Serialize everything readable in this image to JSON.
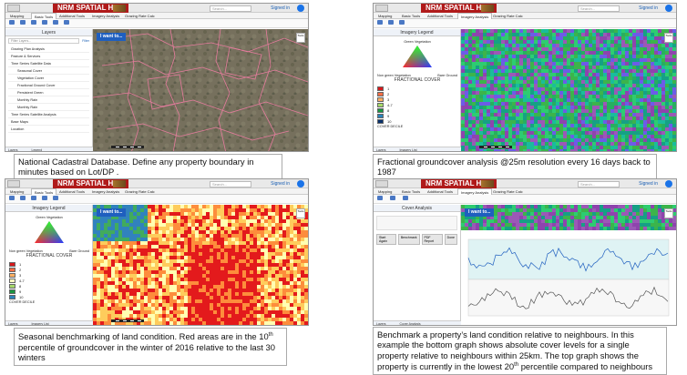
{
  "app": {
    "brand": "NRM SPATIAL HUB",
    "search_placeholder": "Search...",
    "signed_in": "Signed in",
    "tabs": [
      "Mapping",
      "Basic Tools",
      "Additional Tools",
      "Imagery Analysis",
      "Grazing Rate Calc"
    ],
    "i_want_to": "I want to...",
    "tools_label": "Tools"
  },
  "panel1": {
    "sidebar_title": "Layers",
    "filter_placeholder": "Filter Layers...",
    "filter_button": "Filter",
    "layers": [
      "Grazing Plan Analysis",
      "Pasture & Services",
      "Time Series Satellite Data",
      "Seasonal Cover",
      "Vegetation Cover",
      "Fractional Ground Cover",
      "Persistent Green",
      "Monthly Rain",
      "Monthly Rain",
      "Time Series Satellite Analysis",
      "Base Maps",
      "Location"
    ],
    "bottom_tabs": [
      "Layers",
      "Legend"
    ],
    "caption": "National Cadastral Database. Define any property boundary in minutes based on Lot/DP ."
  },
  "panel2": {
    "legend_title": "Imagery Legend",
    "green_label": "Green Vegetation",
    "bare_label": "Bare Ground",
    "non_green_label": "Non green Vegetation",
    "fc_label": "FRACTIONAL COVER",
    "classes": [
      {
        "label": "1",
        "color": "#d7191c"
      },
      {
        "label": "2",
        "color": "#f46d43"
      },
      {
        "label": "3",
        "color": "#fdae61"
      },
      {
        "label": "4-7",
        "color": "#a6d96a"
      },
      {
        "label": "8",
        "color": "#1a9641"
      },
      {
        "label": "9",
        "color": "#2b83ba"
      },
      {
        "label": "10",
        "color": "#08306b"
      }
    ],
    "cover_decile": "COVER DECILE",
    "bottom_tabs": [
      "Layers",
      "Imagery List"
    ],
    "caption": "Fractional groundcover analysis @25m resolution every 16 days back to 1987"
  },
  "panel3": {
    "legend_title": "Imagery Legend",
    "green_label": "Green Vegetation",
    "bare_label": "Bare Ground",
    "non_green_label": "Non green Vegetation",
    "fc_label": "FRACTIONAL COVER",
    "classes": [
      {
        "label": "1",
        "color": "#d7191c"
      },
      {
        "label": "2",
        "color": "#f46d43"
      },
      {
        "label": "3",
        "color": "#fdae61"
      },
      {
        "label": "4-7",
        "color": "#ffffbf"
      },
      {
        "label": "8",
        "color": "#a6d96a"
      },
      {
        "label": "9",
        "color": "#1a9641"
      },
      {
        "label": "10",
        "color": "#2b83ba"
      }
    ],
    "cover_decile": "COVER DECILE",
    "bottom_tabs": [
      "Layers",
      "Imagery List"
    ],
    "caption_a": "Seasonal benchmarking of land condition. Red areas are in the 10",
    "caption_sup": "th",
    "caption_b": " percentile of groundcover in the winter of 2016 relative to the last 30 winters"
  },
  "panel4": {
    "sidebar_title": "Cover Analysis",
    "buttons": [
      "Start Again",
      "Benchmark",
      "PDF Report",
      "Done"
    ],
    "bottom_tabs": [
      "Layers",
      "Cover Analysis"
    ],
    "caption_a": "Benchmark a property’s land condition relative to neighbours. In this example the bottom graph shows absolute cover levels for a single property relative to neighbours within 25km. The top graph shows the property is currently in the lowest 20",
    "caption_sup": "th",
    "caption_b": " percentile compared to neighbours"
  },
  "colors": {
    "brand_red": "#b01a1a",
    "accent_blue": "#1f5fbf"
  }
}
